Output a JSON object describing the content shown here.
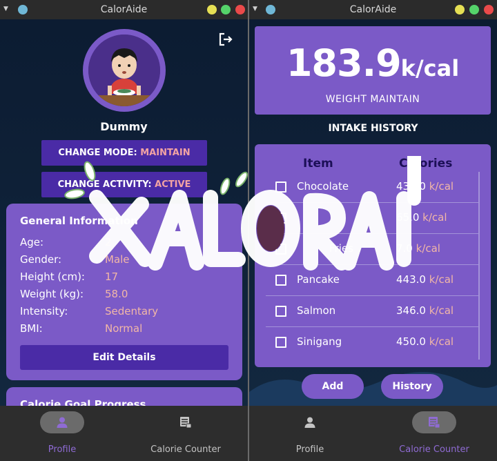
{
  "app": {
    "title_left": "CalorAide",
    "title_right": "CalorAide",
    "watermark": "CALORAIDE"
  },
  "colors": {
    "accent": "#7b5ac7",
    "button": "#4a2ba6",
    "highlight": "#f2b7a7",
    "nav_active": "#8f6bd4"
  },
  "profile": {
    "name": "Dummy",
    "change_mode": {
      "label": "CHANGE MODE: ",
      "value": "MAINTAIN"
    },
    "change_activity": {
      "label": "CHANGE ACTIVITY: ",
      "value": "ACTIVE"
    },
    "general": {
      "title": "General Information",
      "rows": [
        {
          "label": "Age:",
          "value": "2"
        },
        {
          "label": "Gender:",
          "value": "Male"
        },
        {
          "label": "Height (cm):",
          "value": "17"
        },
        {
          "label": "Weight (kg):",
          "value": "58.0"
        },
        {
          "label": "Intensity:",
          "value": "Sedentary"
        },
        {
          "label": "BMI:",
          "value": "Normal"
        }
      ],
      "edit_button": "Edit Details"
    },
    "goal_title": "Calorie Goal Progress"
  },
  "counter": {
    "calories": "183.9",
    "unit": "k/cal",
    "subtitle": "WEIGHT MAINTAIN",
    "intake_title": "INTAKE HISTORY",
    "col_item": "Item",
    "col_calories": "Calories",
    "rows": [
      {
        "item": "Chocolate",
        "cal": "439.0",
        "unit": " k/cal"
      },
      {
        "item": "",
        "cal": "65.0",
        "unit": " k/cal"
      },
      {
        "item": "Fries",
        "cal": "7.0",
        "unit": " k/cal"
      },
      {
        "item": "Pancake",
        "cal": "443.0",
        "unit": " k/cal"
      },
      {
        "item": "Salmon",
        "cal": "346.0",
        "unit": " k/cal"
      },
      {
        "item": "Sinigang",
        "cal": "450.0",
        "unit": " k/cal"
      }
    ],
    "add_button": "Add",
    "history_button": "History"
  },
  "nav": {
    "profile": "Profile",
    "counter": "Calorie Counter"
  }
}
